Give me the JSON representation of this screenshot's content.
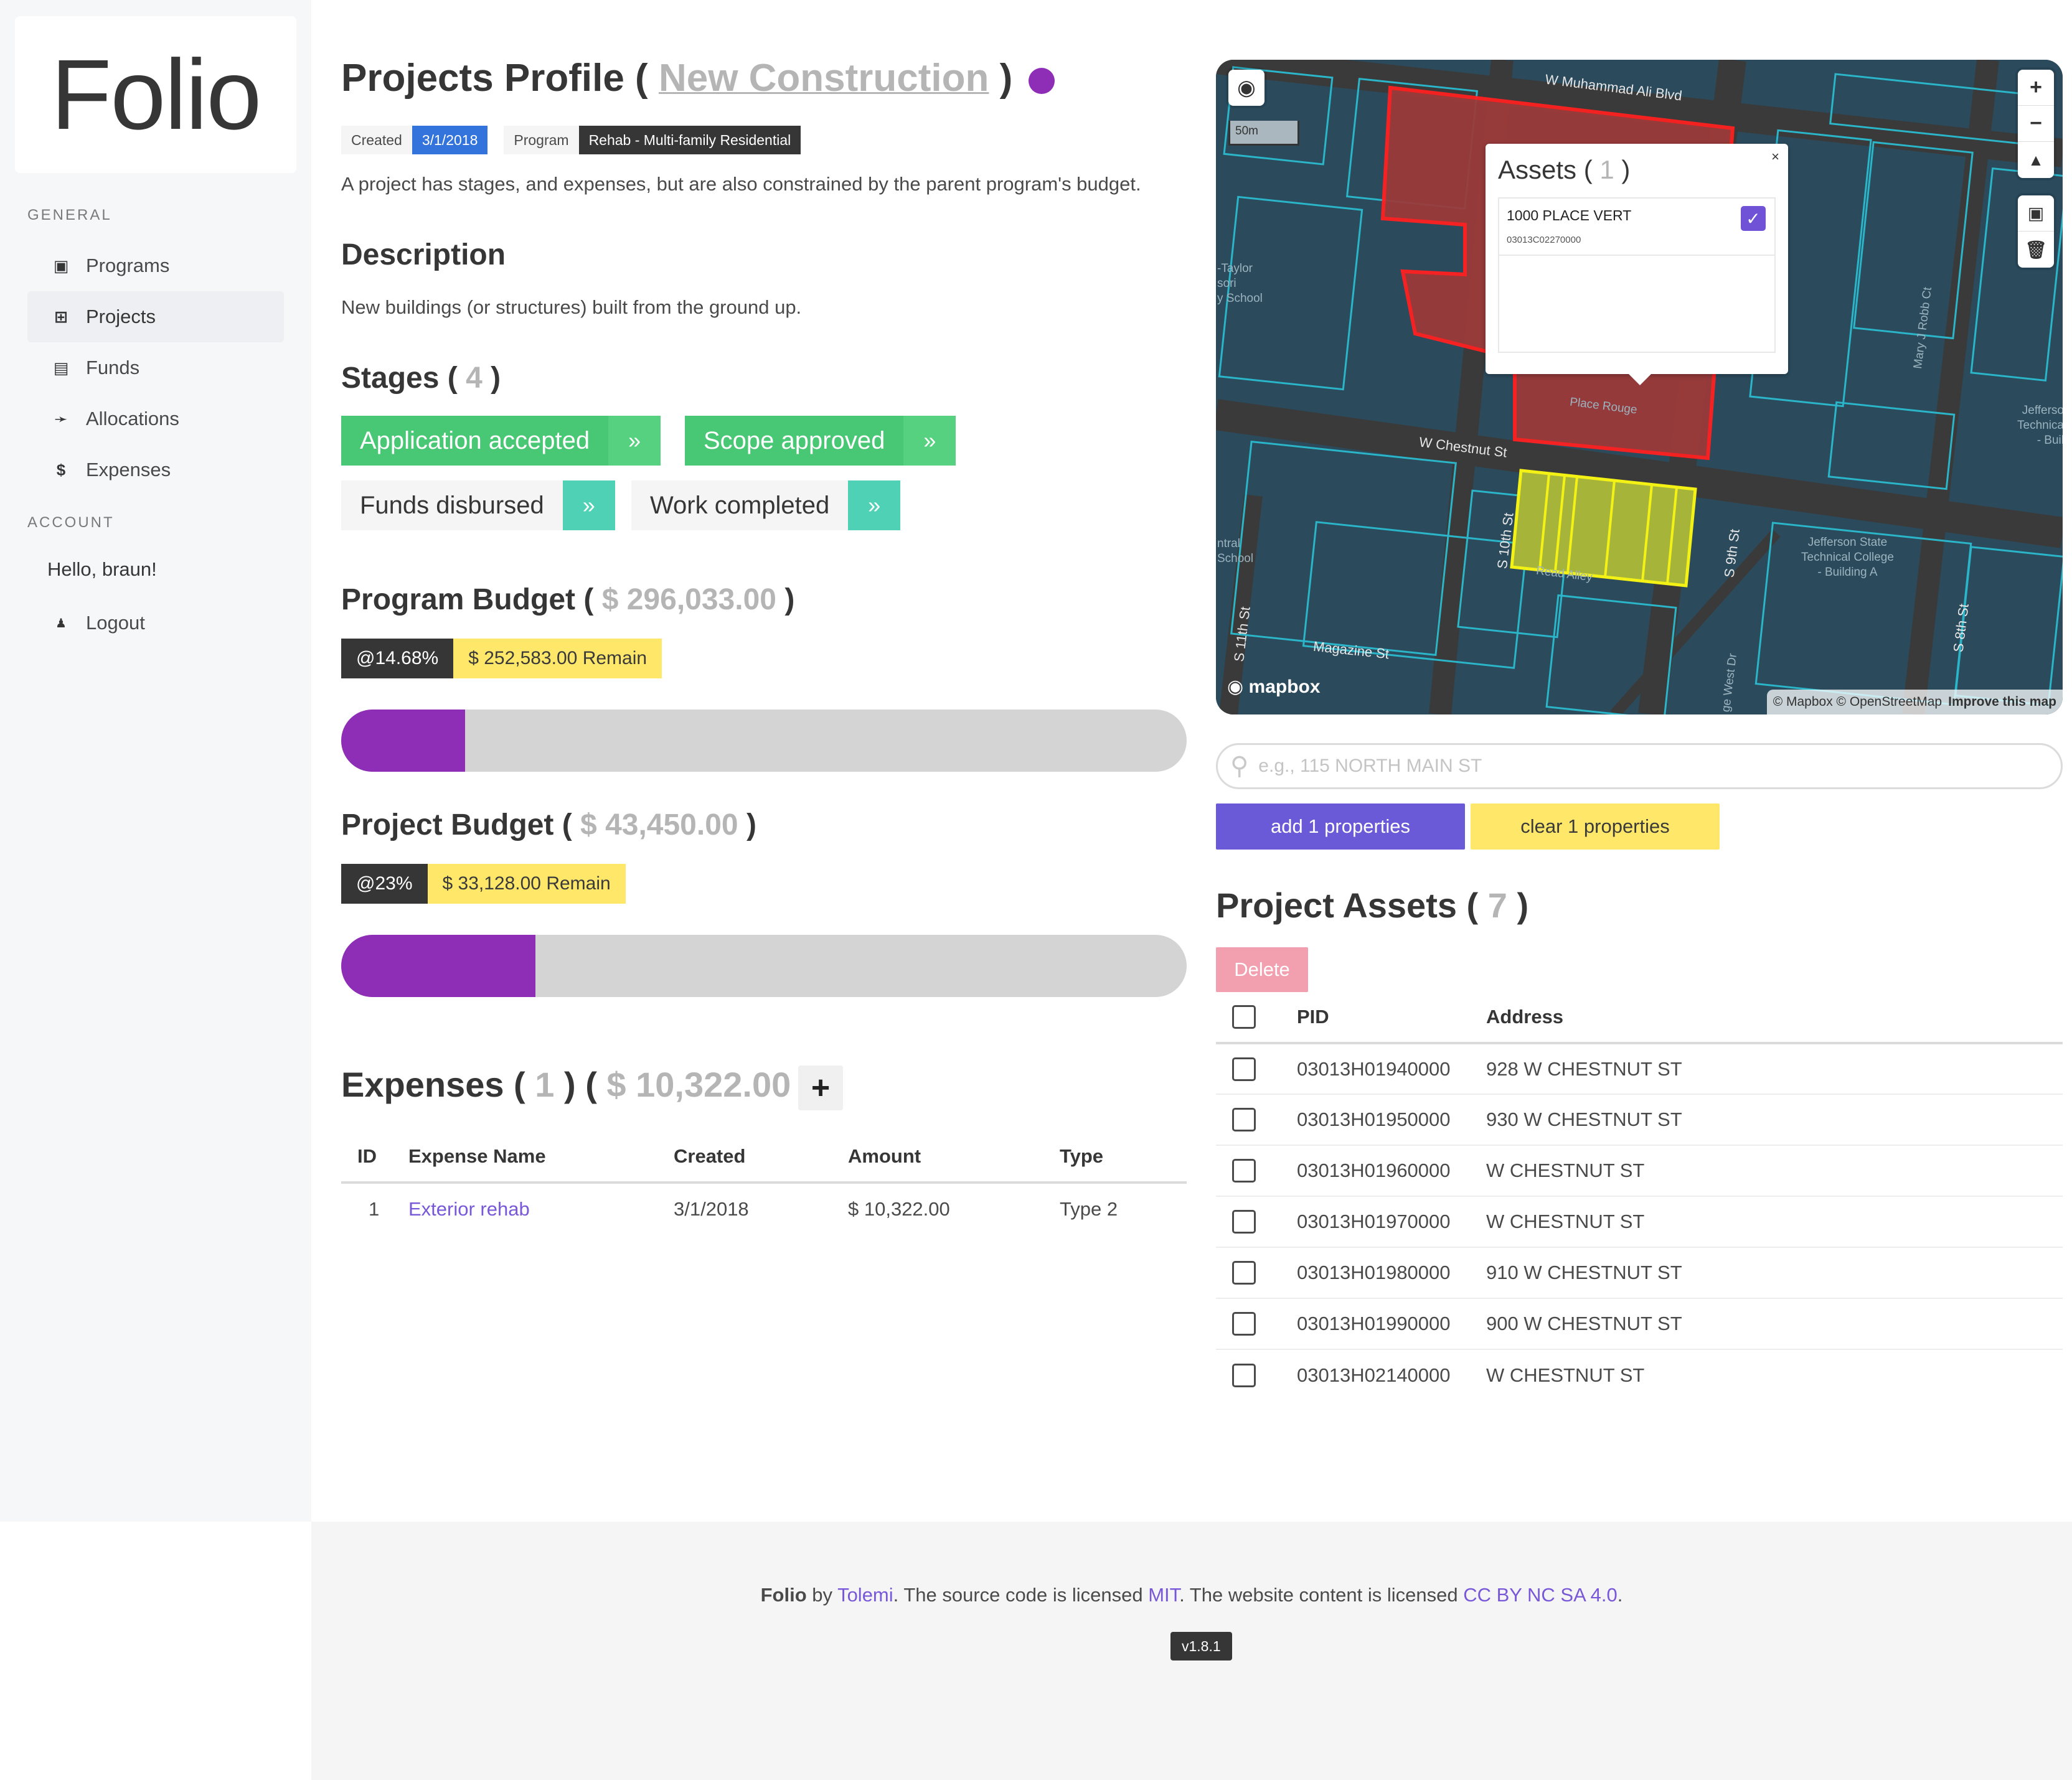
{
  "brand": "Folio",
  "sidebar": {
    "general_label": "GENERAL",
    "items": [
      {
        "label": "Programs",
        "icon": "▣"
      },
      {
        "label": "Projects",
        "icon": "⊞"
      },
      {
        "label": "Funds",
        "icon": "▤"
      },
      {
        "label": "Allocations",
        "icon": "➛"
      },
      {
        "label": "Expenses",
        "icon": "$"
      }
    ],
    "account_label": "ACCOUNT",
    "hello": "Hello, braun!",
    "logout": {
      "label": "Logout",
      "icon": "●"
    }
  },
  "header": {
    "title_prefix": "Projects Profile (",
    "title_link": "New Construction",
    "title_suffix": ")",
    "status_color": "#8e2db5"
  },
  "tags": {
    "created_label": "Created",
    "created_value": "3/1/2018",
    "program_label": "Program",
    "program_value": "Rehab - Multi-family Residential"
  },
  "intro": "A project has stages, and expenses, but are also constrained by the parent program's budget.",
  "description": {
    "heading": "Description",
    "text": "New buildings (or structures) built from the ground up."
  },
  "stages": {
    "heading": "Stages (",
    "count": "4",
    "close": ")",
    "items": [
      {
        "label": "Application accepted",
        "done": true
      },
      {
        "label": "Scope approved",
        "done": true
      },
      {
        "label": "Funds disbursed",
        "done": false
      },
      {
        "label": "Work completed",
        "done": false
      }
    ],
    "arrow": "»"
  },
  "program_budget": {
    "heading": "Program Budget (",
    "amount": "$ 296,033.00",
    "close": ")",
    "percent_label": "@14.68%",
    "remain": "$ 252,583.00 Remain",
    "fraction": 0.1468
  },
  "project_budget": {
    "heading": "Project Budget (",
    "amount": "$ 43,450.00",
    "close": ")",
    "percent_label": "@23%",
    "remain": "$ 33,128.00 Remain",
    "fraction": 0.23
  },
  "expenses": {
    "heading": "Expenses (",
    "count": "1",
    "mid": ") (",
    "total": "$ 10,322.00",
    "close": ")",
    "add": "+",
    "columns": [
      "ID",
      "Expense Name",
      "Created",
      "Amount",
      "Type"
    ],
    "rows": [
      {
        "id": "1",
        "name": "Exterior rehab",
        "created": "3/1/2018",
        "amount": "$ 10,322.00",
        "type": "Type 2"
      }
    ]
  },
  "map": {
    "scale": "50m",
    "popup": {
      "title": "Assets (",
      "count": "1",
      "close_paren": ")",
      "close": "×",
      "item_name": "1000 PLACE VERT",
      "item_pid": "03013C02270000"
    },
    "labels": {
      "muhammad": "W Muhammad Ali Blvd",
      "chestnut": "W Chestnut St",
      "magazine": "Magazine St",
      "tenth": "S 10th St",
      "eleventh": "S 11th St",
      "ninth": "S 9th St",
      "eighth": "S 8th St",
      "place_rouge": "Place Rouge",
      "mary": "Mary J Robb Ct",
      "jefferson": "Jefferson State",
      "jefferson2": "Technical College",
      "jefferson3": "- Building A",
      "read_alley": "Read Alley",
      "taylor1": "-Taylor",
      "taylor2": "sori",
      "taylor3": "y School",
      "central1": "ntral",
      "central2": "School",
      "jeff_r1": "Jefferso",
      "jeff_r2": "Technica",
      "jeff_r3": "- Buil",
      "west_dr": "ge West Dr"
    },
    "logo": "mapbox",
    "attribution": "© Mapbox © OpenStreetMap",
    "improve": "Improve this map"
  },
  "search": {
    "placeholder": "e.g., 115 NORTH MAIN ST",
    "value": ""
  },
  "buttons": {
    "add": "add 1 properties",
    "clear": "clear 1 properties",
    "delete": "Delete"
  },
  "assets": {
    "heading": "Project Assets (",
    "count": "7",
    "close": ")",
    "columns": [
      "PID",
      "Address"
    ],
    "rows": [
      {
        "pid": "03013H01940000",
        "address": "928 W CHESTNUT ST"
      },
      {
        "pid": "03013H01950000",
        "address": "930 W CHESTNUT ST"
      },
      {
        "pid": "03013H01960000",
        "address": "W CHESTNUT ST"
      },
      {
        "pid": "03013H01970000",
        "address": "W CHESTNUT ST"
      },
      {
        "pid": "03013H01980000",
        "address": "910 W CHESTNUT ST"
      },
      {
        "pid": "03013H01990000",
        "address": "900 W CHESTNUT ST"
      },
      {
        "pid": "03013H02140000",
        "address": "W CHESTNUT ST"
      }
    ]
  },
  "footer": {
    "brand": "Folio",
    "by": " by ",
    "author": "Tolemi",
    "t1": ". The source code is licensed ",
    "license_code": "MIT",
    "t2": ". The website content is licensed ",
    "license_content": "CC BY NC SA 4.0",
    "t3": ".",
    "version": "v1.8.1"
  }
}
